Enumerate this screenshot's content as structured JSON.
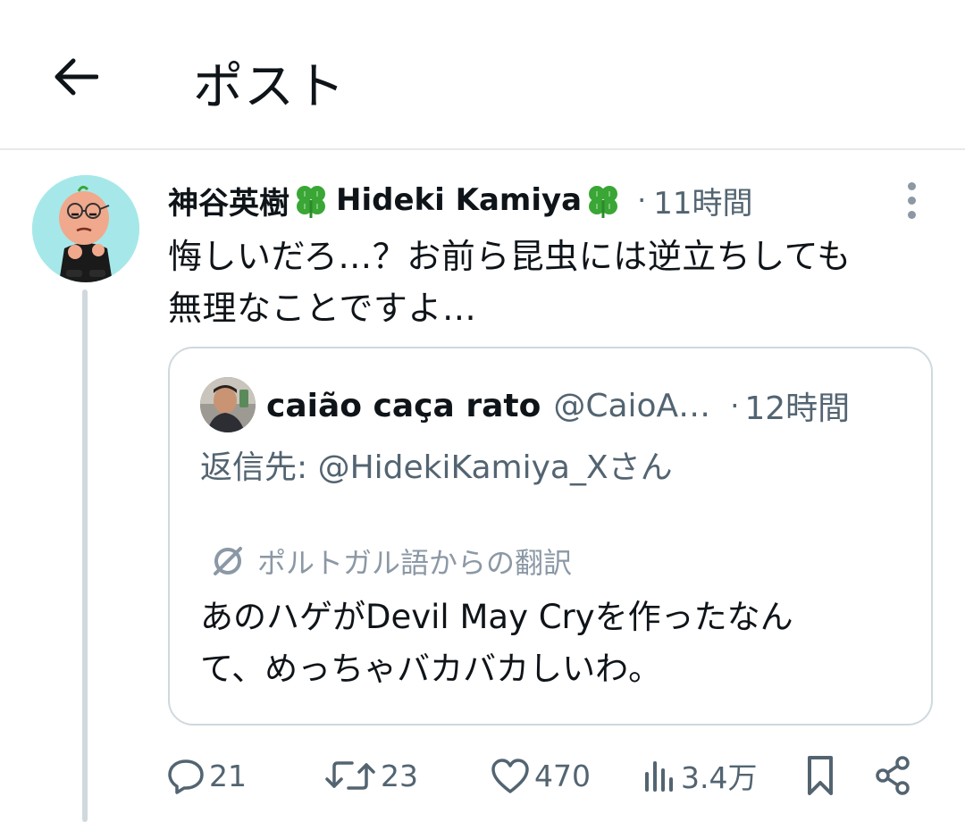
{
  "header": {
    "title": "ポスト"
  },
  "post": {
    "display_name_jp": "神谷英樹",
    "display_name_en": "Hideki Kamiya",
    "separator": "·",
    "time": "11時間",
    "text_line1": "悔しいだろ…？お前ら昆虫には逆立ちしても",
    "text_line2": "無理なことですよ…"
  },
  "quote": {
    "display_name": "caião caça rato",
    "handle": "@CaioA…",
    "separator": "·",
    "time": "12時間",
    "reply_to": "返信先: @HidekiKamiya_Xさん",
    "translation_label": "ポルトガル語からの翻訳",
    "text_line1": "あのハゲがDevil May Cryを作ったなん",
    "text_line2": "て、めっちゃバカバカしいわ。"
  },
  "actions": {
    "replies": "21",
    "reposts": "23",
    "likes": "470",
    "views": "3.4万"
  },
  "colors": {
    "text": "#0f1419",
    "secondary": "#536471",
    "border": "#cfd9de",
    "avatar_bg": "#a6e8ea",
    "clover": "#3aa635"
  },
  "icons": [
    "back-arrow-icon",
    "clover-icon",
    "more-icon",
    "translate-icon",
    "reply-icon",
    "repost-icon",
    "like-icon",
    "views-icon",
    "bookmark-icon",
    "share-icon"
  ]
}
